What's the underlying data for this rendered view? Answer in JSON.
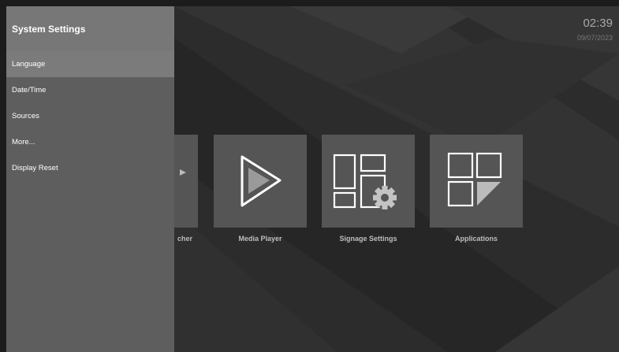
{
  "clock": {
    "time": "02:39",
    "date": "09/07/2023"
  },
  "sidebar": {
    "title": "System Settings",
    "items": [
      {
        "label": "Language",
        "active": true
      },
      {
        "label": "Date/Time"
      },
      {
        "label": "Sources"
      },
      {
        "label": "More..."
      },
      {
        "label": "Display Reset"
      }
    ]
  },
  "tiles": [
    {
      "label": "cher",
      "icon": "launcher-icon"
    },
    {
      "label": "Media Player",
      "icon": "play-icon"
    },
    {
      "label": "Signage Settings",
      "icon": "signage-settings-icon"
    },
    {
      "label": "Applications",
      "icon": "applications-icon"
    }
  ]
}
